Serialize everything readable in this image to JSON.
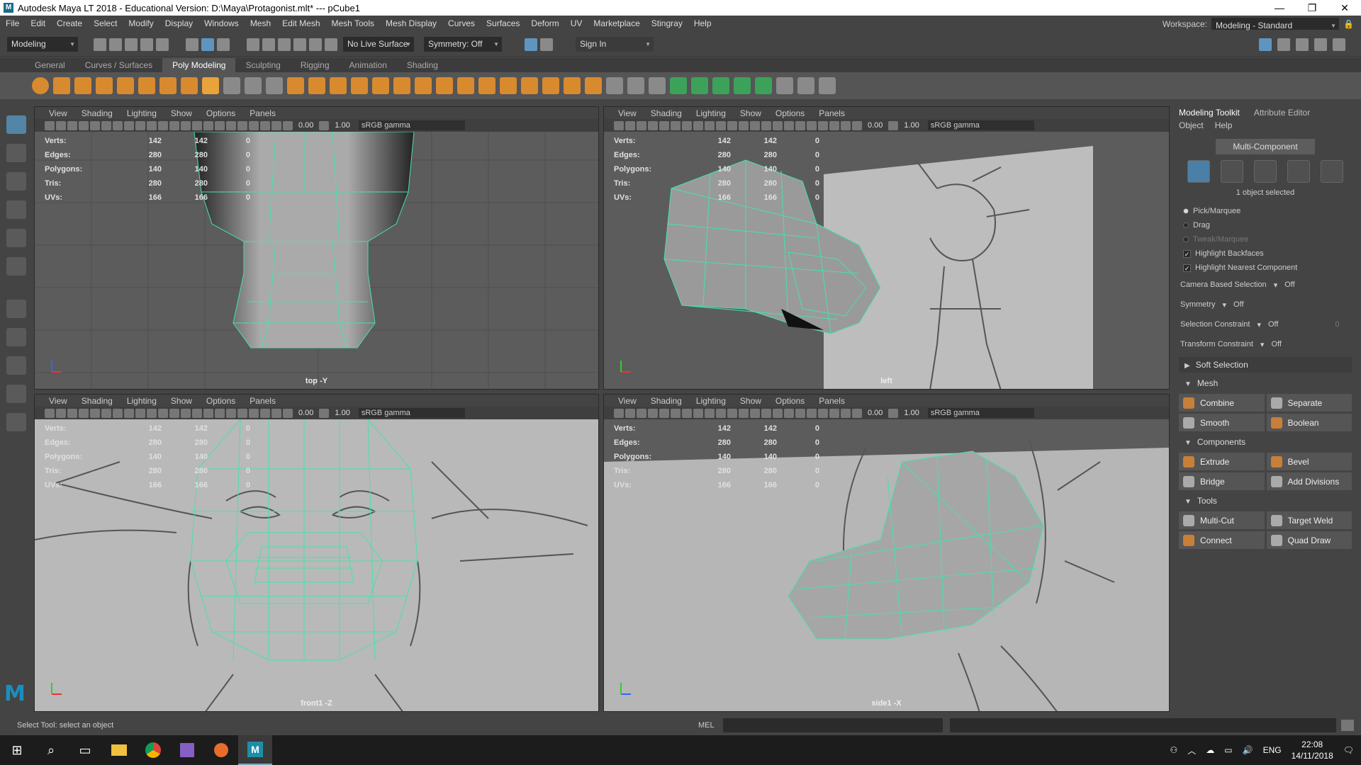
{
  "titlebar": {
    "title": "Autodesk Maya LT 2018 - Educational Version: D:\\Maya\\Protagonist.mlt*  ---  pCube1",
    "minimize": "—",
    "maximize": "❐",
    "close": "✕"
  },
  "menu": [
    "File",
    "Edit",
    "Create",
    "Select",
    "Modify",
    "Display",
    "Windows",
    "Mesh",
    "Edit Mesh",
    "Mesh Tools",
    "Mesh Display",
    "Curves",
    "Surfaces",
    "Deform",
    "UV",
    "Marketplace",
    "Stingray",
    "Help"
  ],
  "workspace": {
    "label": "Workspace:",
    "value": "Modeling - Standard"
  },
  "statusline": {
    "mode": "Modeling",
    "live_surface": "No Live Surface",
    "symmetry": "Symmetry: Off",
    "signin": "Sign In"
  },
  "shelf_tabs": [
    "General",
    "Curves / Surfaces",
    "Poly Modeling",
    "Sculpting",
    "Rigging",
    "Animation",
    "Shading"
  ],
  "shelf_active": "Poly Modeling",
  "panel_menu": [
    "View",
    "Shading",
    "Lighting",
    "Show",
    "Options",
    "Panels"
  ],
  "panel_bar": {
    "exposure": "0.00",
    "gamma": "1.00",
    "colorspace": "sRGB gamma"
  },
  "hud": {
    "labels": [
      "Verts:",
      "Edges:",
      "Polygons:",
      "Tris:",
      "UVs:"
    ],
    "col1": [
      "142",
      "280",
      "140",
      "280",
      "166"
    ],
    "col2": [
      "142",
      "280",
      "140",
      "280",
      "166"
    ],
    "col3": [
      "0",
      "0",
      "0",
      "0",
      "0"
    ]
  },
  "viewports": {
    "top": "top -Y",
    "left": "left",
    "front": "front1 -Z",
    "side": "side1 -X"
  },
  "toolkit": {
    "tab1": "Modeling Toolkit",
    "tab2": "Attribute Editor",
    "sub1": "Object",
    "sub2": "Help",
    "multi": "Multi-Component",
    "selected": "1 object selected",
    "pick": "Pick/Marquee",
    "drag": "Drag",
    "tweak": "Tweak/Marquee",
    "backfaces": "Highlight Backfaces",
    "nearest": "Highlight Nearest Component",
    "camera_sel": "Camera Based Selection",
    "camera_sel_val": "Off",
    "symmetry": "Symmetry",
    "symmetry_val": "Off",
    "sel_constraint": "Selection Constraint",
    "sel_constraint_val": "Off",
    "sel_constraint_num": "0",
    "xf_constraint": "Transform Constraint",
    "xf_constraint_val": "Off",
    "soft": "Soft Selection",
    "mesh": "Mesh",
    "combine": "Combine",
    "separate": "Separate",
    "smooth": "Smooth",
    "boolean": "Boolean",
    "components": "Components",
    "extrude": "Extrude",
    "bevel": "Bevel",
    "bridge": "Bridge",
    "add_div": "Add Divisions",
    "tools": "Tools",
    "multicut": "Multi-Cut",
    "target_weld": "Target Weld",
    "connect": "Connect",
    "quad_draw": "Quad Draw"
  },
  "helpline": {
    "text": "Select Tool: select an object",
    "mel": "MEL"
  },
  "taskbar": {
    "lang": "ENG",
    "time": "22:08",
    "date": "14/11/2018"
  },
  "colors": {
    "accent": "#5285a6",
    "wire": "#46e3a8"
  }
}
